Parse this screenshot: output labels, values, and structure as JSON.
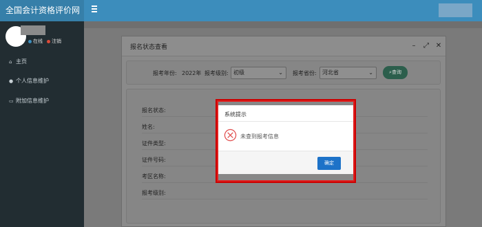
{
  "app": {
    "title": "全国会计资格评价网"
  },
  "topbar": {
    "menu_icon": "hamburger-icon"
  },
  "sidebar": {
    "status_online": "在线",
    "status_logout": "注销",
    "online_color": "#3c8dbc",
    "logout_color": "#dd4b39",
    "items": [
      {
        "label": "主页",
        "icon": "home-icon"
      },
      {
        "label": "个人信息维护",
        "icon": "user-icon"
      },
      {
        "label": "附加信息维护",
        "icon": "card-icon"
      }
    ]
  },
  "modal": {
    "title": "报名状态查看",
    "filters": {
      "year_label": "报考年份:",
      "year_value": "2022年",
      "level_label": "报考级别:",
      "level_value": "初级",
      "province_label": "报考省份:",
      "province_value": "河北省",
      "query_label": "查询"
    },
    "info_labels": [
      "报名状态:",
      "姓名:",
      "证件类型:",
      "证件号码:",
      "考区名称:",
      "报考级别:"
    ]
  },
  "alert": {
    "title": "系统提示",
    "message": "未查到报考信息",
    "ok_label": "确定",
    "accent": "#1d72c8",
    "highlight": "#e0201f"
  }
}
